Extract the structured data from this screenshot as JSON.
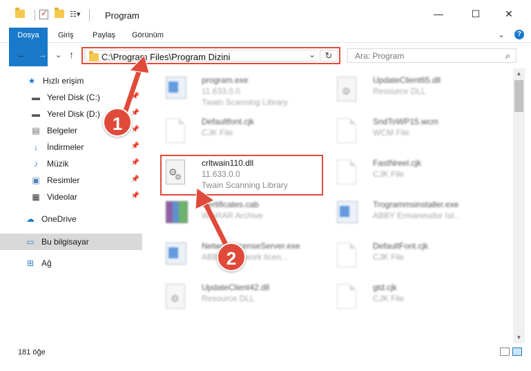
{
  "window": {
    "title": "Program",
    "minimize_glyph": "—",
    "maximize_glyph": "☐",
    "close_glyph": "✕"
  },
  "ribbon": {
    "tabs": [
      "Dosya",
      "Giriş",
      "Paylaş",
      "Görünüm"
    ],
    "expand_glyph": "⌄",
    "help_glyph": "?"
  },
  "nav": {
    "back_glyph": "←",
    "forward_glyph": "→",
    "recent_glyph": "⌄",
    "up_glyph": "↑",
    "address": "C:\\Program Files\\Program Dizini",
    "address_chevron": "⌄",
    "refresh_glyph": "↻",
    "search_placeholder": "Ara: Program",
    "search_glyph": "⌕"
  },
  "sidebar": {
    "items": [
      {
        "label": "Hızlı erişim",
        "icon": "star-icon",
        "pinned": false
      },
      {
        "label": "Yerel Disk (C:)",
        "icon": "drive-icon",
        "pinned": true
      },
      {
        "label": "Yerel Disk (D:)",
        "icon": "drive-icon",
        "pinned": true
      },
      {
        "label": "Belgeler",
        "icon": "documents-icon",
        "pinned": true
      },
      {
        "label": "İndirmeler",
        "icon": "download-icon",
        "pinned": true
      },
      {
        "label": "Müzik",
        "icon": "music-icon",
        "pinned": true
      },
      {
        "label": "Resimler",
        "icon": "pictures-icon",
        "pinned": true
      },
      {
        "label": "Videolar",
        "icon": "videos-icon",
        "pinned": true
      },
      {
        "label": "OneDrive",
        "icon": "cloud-icon",
        "pinned": false
      },
      {
        "label": "Bu bilgisayar",
        "icon": "computer-icon",
        "pinned": false
      },
      {
        "label": "Ağ",
        "icon": "network-icon",
        "pinned": false
      }
    ],
    "pin_glyph": "📌"
  },
  "files": [
    {
      "name": "program.exe",
      "line2": "11.633.0.0",
      "line3": "Twain Scanning Library",
      "icon": "exe-icon"
    },
    {
      "name": "UpdateClient65.dll",
      "line2": "Resource DLL",
      "line3": "",
      "icon": "dll-icon"
    },
    {
      "name": "Defaultfont.cjk",
      "line2": "CJK File",
      "line3": "",
      "icon": "document-icon"
    },
    {
      "name": "SndToWP15.wcm",
      "line2": "WCM File",
      "line3": "",
      "icon": "document-icon"
    },
    {
      "name": "crltwain110.dll",
      "line2": "11.633.0.0",
      "line3": "Twain Scanning Library",
      "icon": "dll-icon"
    },
    {
      "name": "FastNreel.cjk",
      "line2": "CJK File",
      "line3": "",
      "icon": "document-icon"
    },
    {
      "name": "Certificates.cab",
      "line2": "WinRAR Archive",
      "line3": "",
      "icon": "archive-icon"
    },
    {
      "name": "Trogrammsinstaller.exe",
      "line2": "ABBY Ermaneudor Ist...",
      "line3": "",
      "icon": "installer-icon"
    },
    {
      "name": "NetworkLicenseServer.exe",
      "line2": "ABBYY Network licen...",
      "line3": "",
      "icon": "exe-icon"
    },
    {
      "name": "DefaultFont.cjk",
      "line2": "CJK File",
      "line3": "",
      "icon": "document-icon"
    },
    {
      "name": "UpdateClient42.dll",
      "line2": "Resource DLL",
      "line3": "",
      "icon": "dll-icon"
    },
    {
      "name": "gtd.cjk",
      "line2": "CJK File",
      "line3": "",
      "icon": "document-icon"
    }
  ],
  "status": {
    "item_count": "181 öğe"
  },
  "annotations": {
    "badge_1": "1",
    "badge_2": "2",
    "color": "#e04a3a"
  }
}
